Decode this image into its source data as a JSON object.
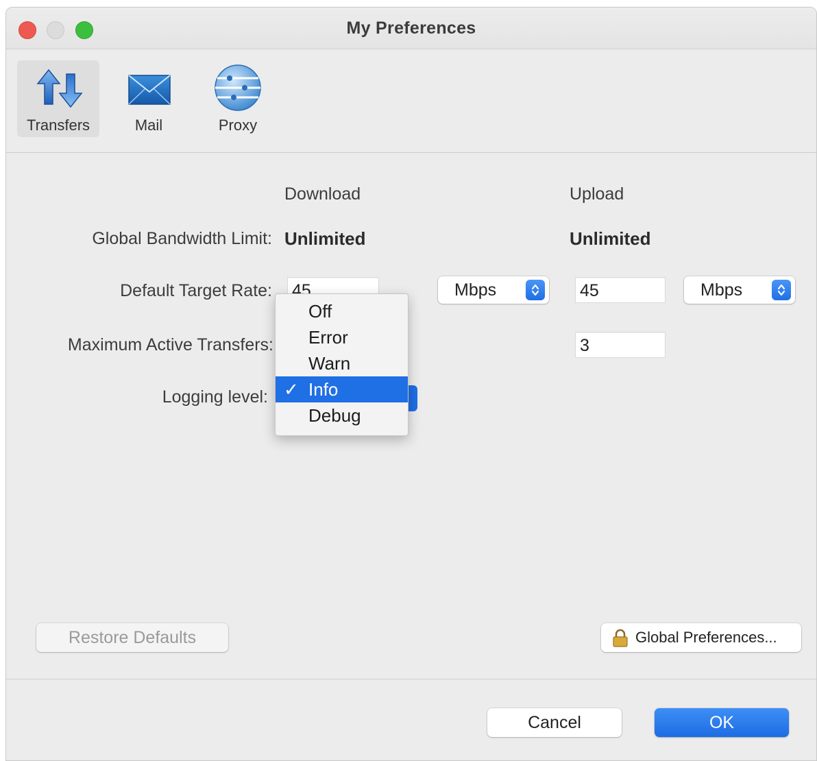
{
  "window": {
    "title": "My Preferences"
  },
  "toolbar": {
    "items": [
      {
        "label": "Transfers",
        "icon": "transfers-arrows-icon",
        "selected": true
      },
      {
        "label": "Mail",
        "icon": "mail-envelope-icon",
        "selected": false
      },
      {
        "label": "Proxy",
        "icon": "proxy-globe-icon",
        "selected": false
      }
    ]
  },
  "transfers": {
    "col_download": "Download",
    "col_upload": "Upload",
    "bandwidth_label": "Global Bandwidth Limit:",
    "bandwidth_download": "Unlimited",
    "bandwidth_upload": "Unlimited",
    "target_rate_label": "Default Target Rate:",
    "target_rate_download": "45",
    "target_rate_download_unit": "Mbps",
    "target_rate_upload": "45",
    "target_rate_upload_unit": "Mbps",
    "max_active_label": "Maximum Active Transfers:",
    "max_active_upload": "3",
    "logging_label": "Logging level:",
    "logging_selected": "Info"
  },
  "logging_menu": {
    "items": [
      "Off",
      "Error",
      "Warn",
      "Info",
      "Debug"
    ],
    "checkmark": "✓"
  },
  "buttons": {
    "restore_defaults": "Restore Defaults",
    "global_preferences": "Global Preferences...",
    "cancel": "Cancel",
    "ok": "OK"
  },
  "colors": {
    "accent": "#1f6fe5",
    "close": "#ee5a52",
    "zoom": "#3cbe3f"
  }
}
